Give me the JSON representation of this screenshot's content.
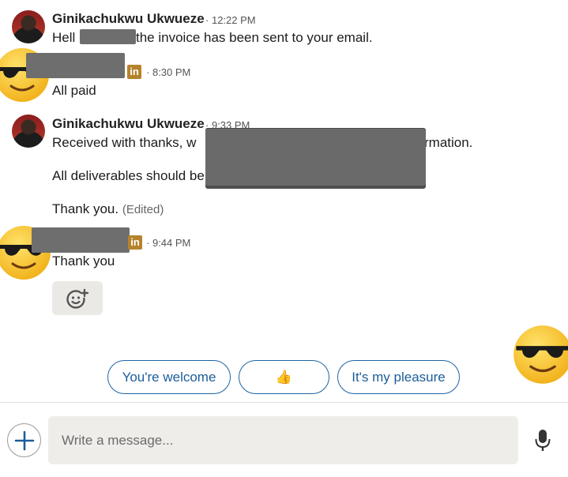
{
  "messages": [
    {
      "sender": "Ginikachukwu Ukwueze",
      "time": "12:22 PM",
      "text_before": "Hell",
      "text_after": "the invoice has been sent to your email."
    },
    {
      "sender_redacted": true,
      "badge": "in",
      "time": "8:30 PM",
      "text": "All paid"
    },
    {
      "sender": "Ginikachukwu Ukwueze",
      "time": "9:33 PM",
      "line1_start": "Received with thanks, w",
      "line1_end": "rmation.",
      "line2_start": "All deliverables should be",
      "line3": "Thank you.",
      "line3_edited": "(Edited)"
    },
    {
      "sender_redacted": true,
      "badge": "in",
      "time": "9:44 PM",
      "text": "Thank you"
    }
  ],
  "separator": "·",
  "smart_replies": [
    "You're welcome",
    "👍",
    "It's my pleasure"
  ],
  "compose": {
    "placeholder": "Write a message..."
  },
  "icons": {
    "add": "plus-icon",
    "mic": "microphone-icon",
    "react": "add-reaction-icon",
    "sticker": "sunglasses-emoji"
  },
  "colors": {
    "accent": "#1c5d99",
    "linkedin_badge": "#b5832b",
    "compose_bg": "#efedea",
    "redaction": "#6e6e6e"
  }
}
